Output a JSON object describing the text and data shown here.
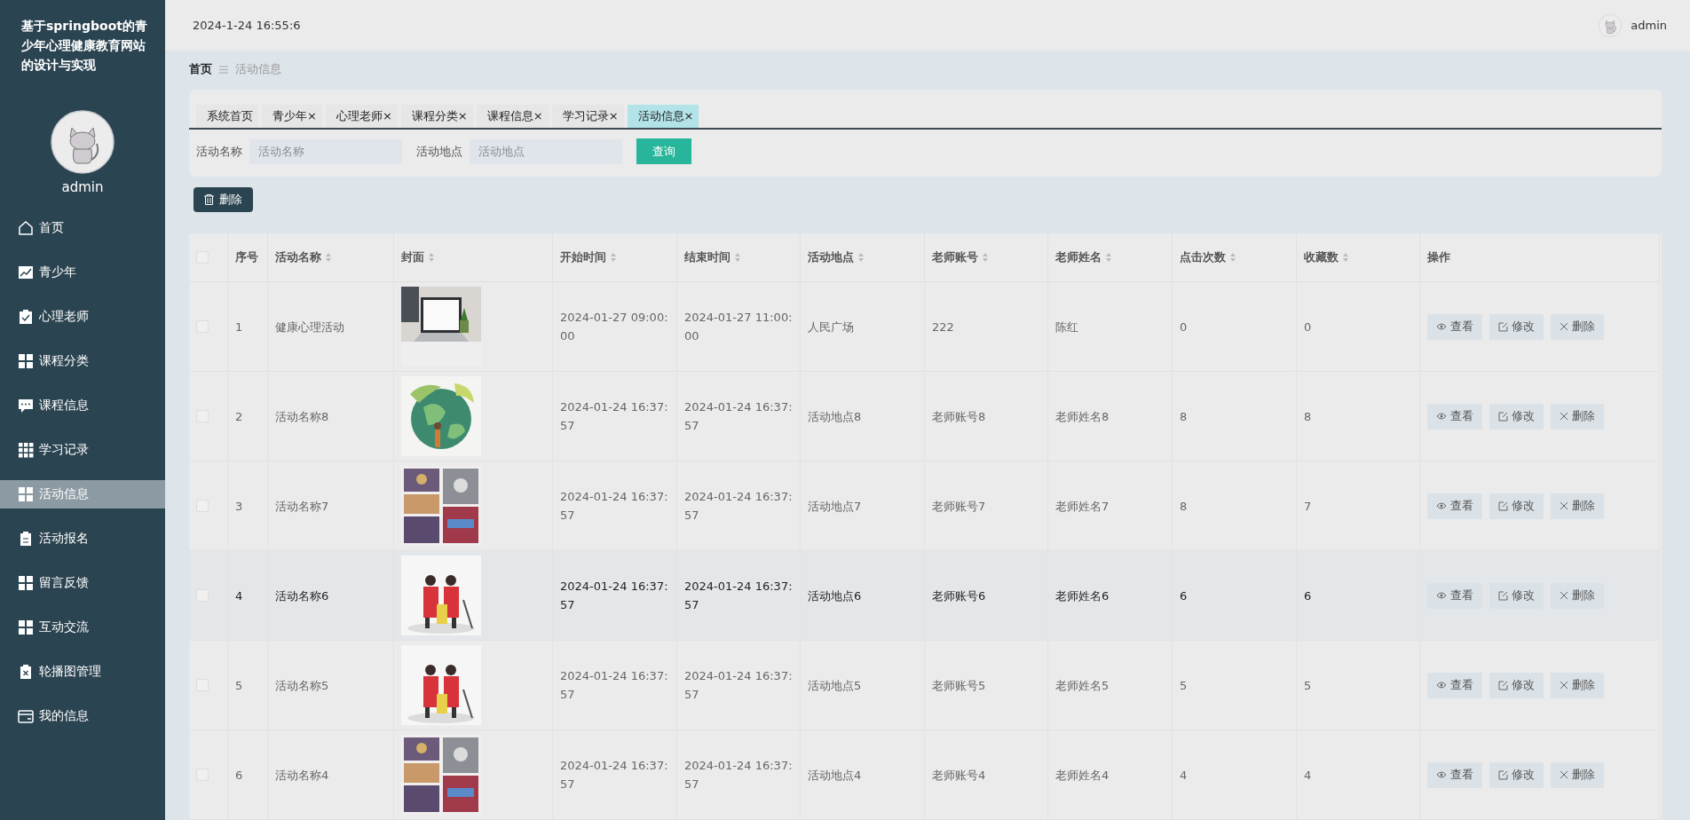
{
  "sidebar": {
    "title": "基于springboot的青少年心理健康教育网站的设计与实现",
    "user": "admin",
    "items": [
      {
        "label": "首页",
        "kind": "home",
        "selected": false
      },
      {
        "label": "青少年",
        "kind": "chart",
        "selected": false
      },
      {
        "label": "心理老师",
        "kind": "clipcheck",
        "selected": false
      },
      {
        "label": "课程分类",
        "kind": "grid4",
        "selected": false
      },
      {
        "label": "课程信息",
        "kind": "chat",
        "selected": false
      },
      {
        "label": "学习记录",
        "kind": "grid9",
        "selected": false
      },
      {
        "label": "活动信息",
        "kind": "grid4",
        "selected": true
      },
      {
        "label": "活动报名",
        "kind": "clip",
        "selected": false
      },
      {
        "label": "留言反馈",
        "kind": "grid4",
        "selected": false
      },
      {
        "label": "互动交流",
        "kind": "grid4",
        "selected": false
      },
      {
        "label": "轮播图管理",
        "kind": "clipx",
        "selected": false
      },
      {
        "label": "我的信息",
        "kind": "wallet",
        "selected": false
      }
    ]
  },
  "header": {
    "time": "2024-1-24 16:55:6",
    "user": "admin"
  },
  "breadcrumb": [
    "首页",
    "活动信息"
  ],
  "tabs": [
    {
      "label": "系统首页",
      "selected": false
    },
    {
      "label": "青少年",
      "close": "×",
      "selected": false
    },
    {
      "label": "心理老师",
      "close": "×",
      "selected": false
    },
    {
      "label": "课程分类",
      "close": "×",
      "selected": false
    },
    {
      "label": "课程信息",
      "close": "×",
      "selected": false
    },
    {
      "label": "学习记录",
      "close": "×",
      "selected": false
    },
    {
      "label": "活动信息",
      "close": "×",
      "selected": true
    }
  ],
  "search": [
    {
      "label": "活动名称",
      "placeholder": "活动名称"
    },
    {
      "label": "活动地点",
      "placeholder": "活动地点"
    }
  ],
  "search_button": "查询",
  "delete_button": "删除",
  "table": {
    "all_checked": false,
    "columns": [
      {
        "label": "序号",
        "sortable": false
      },
      {
        "label": "活动名称",
        "sortable": true
      },
      {
        "label": "封面",
        "sortable": true
      },
      {
        "label": "开始时间",
        "sortable": true
      },
      {
        "label": "结束时间",
        "sortable": true
      },
      {
        "label": "活动地点",
        "sortable": true
      },
      {
        "label": "老师账号",
        "sortable": true
      },
      {
        "label": "老师姓名",
        "sortable": true
      },
      {
        "label": "点击次数",
        "sortable": true
      },
      {
        "label": "收藏数",
        "sortable": true
      },
      {
        "label": "操作",
        "sortable": false
      }
    ],
    "rows": [
      {
        "checked": false,
        "highlighted": false,
        "cells": [
          "1",
          "健康心理活动",
          "",
          "2024-01-27 09:00:00",
          "2024-01-27 11:00:00",
          "人民广场",
          "222",
          "陈红",
          "0",
          "0"
        ],
        "actions": [
          "查看",
          "修改",
          "删除"
        ]
      },
      {
        "checked": false,
        "highlighted": false,
        "cells": [
          "2",
          "活动名称8",
          "",
          "2024-01-24 16:37:57",
          "2024-01-24 16:37:57",
          "活动地点8",
          "老师账号8",
          "老师姓名8",
          "8",
          "8"
        ],
        "actions": [
          "查看",
          "修改",
          "删除"
        ]
      },
      {
        "checked": false,
        "highlighted": false,
        "cells": [
          "3",
          "活动名称7",
          "",
          "2024-01-24 16:37:57",
          "2024-01-24 16:37:57",
          "活动地点7",
          "老师账号7",
          "老师姓名7",
          "8",
          "7"
        ],
        "actions": [
          "查看",
          "修改",
          "删除"
        ]
      },
      {
        "checked": false,
        "highlighted": true,
        "cells": [
          "4",
          "活动名称6",
          "",
          "2024-01-24 16:37:57",
          "2024-01-24 16:37:57",
          "活动地点6",
          "老师账号6",
          "老师姓名6",
          "6",
          "6"
        ],
        "actions": [
          "查看",
          "修改",
          "删除"
        ]
      },
      {
        "checked": false,
        "highlighted": false,
        "cells": [
          "5",
          "活动名称5",
          "",
          "2024-01-24 16:37:57",
          "2024-01-24 16:37:57",
          "活动地点5",
          "老师账号5",
          "老师姓名5",
          "5",
          "5"
        ],
        "actions": [
          "查看",
          "修改",
          "删除"
        ]
      },
      {
        "checked": false,
        "highlighted": false,
        "cells": [
          "6",
          "活动名称4",
          "",
          "2024-01-24 16:37:57",
          "2024-01-24 16:37:57",
          "活动地点4",
          "老师账号4",
          "老师姓名4",
          "4",
          "4"
        ],
        "actions": [
          "查看",
          "修改",
          "删除"
        ]
      }
    ]
  }
}
